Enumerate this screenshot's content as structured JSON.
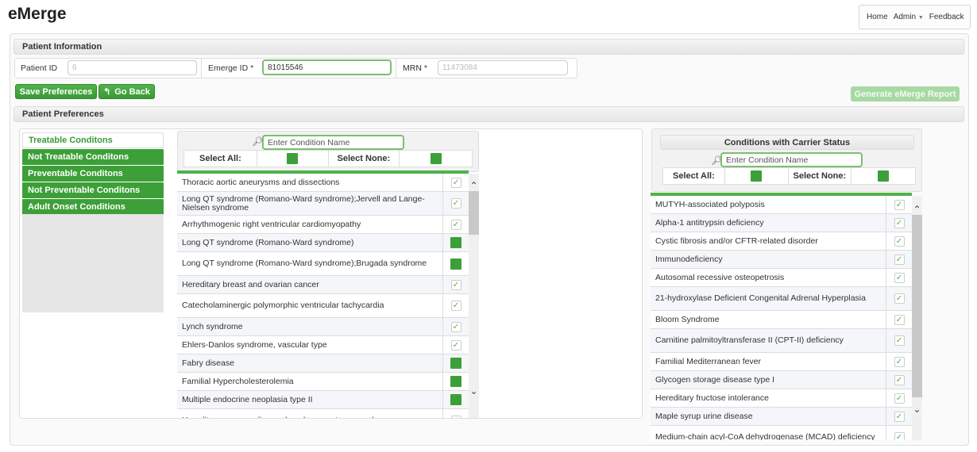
{
  "app": {
    "title": "eMerge"
  },
  "topnav": {
    "home": "Home",
    "admin": "Admin",
    "feedback": "Feedback"
  },
  "patient_info": {
    "header": "Patient Information",
    "patient_id_label": "Patient ID",
    "patient_id_value": "6",
    "emerge_id_label": "Emerge ID *",
    "emerge_id_value": "81015546",
    "mrn_label": "MRN *",
    "mrn_value": "11473084"
  },
  "buttons": {
    "save": "Save Preferences",
    "back_icon": "undo-arrow-icon",
    "back": "Go Back",
    "generate": "Generate eMerge Report"
  },
  "patient_prefs": {
    "header": "Patient Preferences"
  },
  "categories": [
    {
      "label": "Treatable Conditons",
      "active": true
    },
    {
      "label": "Not Treatable Conditons",
      "active": false
    },
    {
      "label": "Preventable Conditons",
      "active": false
    },
    {
      "label": "Not Preventable Conditons",
      "active": false
    },
    {
      "label": "Adult Onset Conditions",
      "active": false
    }
  ],
  "conditions_panel": {
    "search_placeholder": "Enter Condition Name",
    "select_all": "Select All:",
    "select_none": "Select None:",
    "rows": [
      {
        "name": "Thoracic aortic aneurysms and dissections",
        "state": "checked"
      },
      {
        "name": "Long QT syndrome (Romano-Ward syndrome);Jervell and Lange-Nielsen syndrome",
        "state": "checked"
      },
      {
        "name": "Arrhythmogenic right ventricular cardiomyopathy",
        "state": "checked"
      },
      {
        "name": "Long QT syndrome (Romano-Ward syndrome)",
        "state": "green"
      },
      {
        "name": "Long QT syndrome (Romano-Ward syndrome);Brugada syndrome",
        "state": "green"
      },
      {
        "name": "Hereditary breast and ovarian cancer",
        "state": "checked"
      },
      {
        "name": "Catecholaminergic polymorphic ventricular tachycardia",
        "state": "checked"
      },
      {
        "name": "Lynch syndrome",
        "state": "checked"
      },
      {
        "name": "Ehlers-Danlos syndrome, vascular type",
        "state": "checked"
      },
      {
        "name": "Fabry disease",
        "state": "green"
      },
      {
        "name": "Familial Hypercholesterolemia",
        "state": "green"
      },
      {
        "name": "Multiple endocrine neoplasia type II",
        "state": "green"
      },
      {
        "name": "Hereditary paraganglioma-pheochromocytoma syndromes",
        "state": "checked"
      }
    ]
  },
  "carrier_panel": {
    "title": "Conditions with Carrier Status",
    "search_placeholder": "Enter Condition Name",
    "select_all": "Select All:",
    "select_none": "Select None:",
    "rows": [
      {
        "name": "MUTYH-associated polyposis",
        "state": "checked"
      },
      {
        "name": "Alpha-1 antitrypsin deficiency",
        "state": "checked"
      },
      {
        "name": "Cystic fibrosis and/or CFTR-related disorder",
        "state": "checked"
      },
      {
        "name": "Immunodeficiency",
        "state": "checked"
      },
      {
        "name": "Autosomal recessive osteopetrosis",
        "state": "checked"
      },
      {
        "name": "21-hydroxylase Deficient Congenital Adrenal Hyperplasia",
        "state": "checked"
      },
      {
        "name": "Bloom Syndrome",
        "state": "checked"
      },
      {
        "name": "Carnitine palmitoyltransferase II (CPT-II) deficiency",
        "state": "checked"
      },
      {
        "name": "Familial Mediterranean fever",
        "state": "checked"
      },
      {
        "name": "Glycogen storage disease type I",
        "state": "checked"
      },
      {
        "name": "Hereditary fructose intolerance",
        "state": "checked"
      },
      {
        "name": "Maple syrup urine disease",
        "state": "checked"
      },
      {
        "name": "Medium-chain acyl-CoA dehydrogenase (MCAD) deficiency",
        "state": "checked"
      }
    ]
  },
  "icons": {
    "search": "search-icon",
    "check": "checkmark-icon",
    "scroll_up": "chevron-up-icon",
    "scroll_down": "chevron-down-icon",
    "dropdown": "caret-down-icon"
  },
  "colors": {
    "accent_green": "#3d9f38",
    "light_green": "#a9d9a3"
  }
}
